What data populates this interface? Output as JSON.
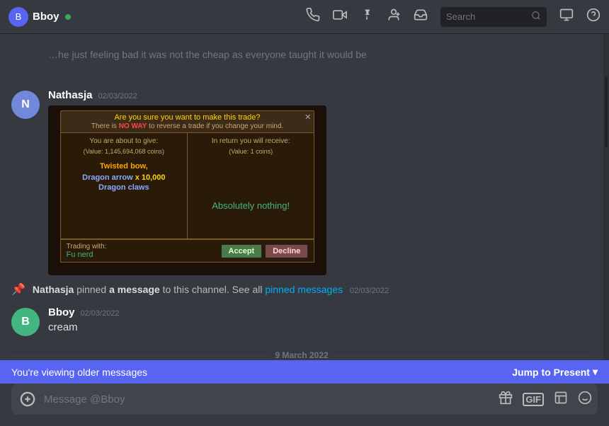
{
  "header": {
    "channel_icon": "B",
    "channel_name": "Bboy",
    "search_placeholder": "Search"
  },
  "messages": [
    {
      "id": "msg-nathasja-1",
      "username": "Nathasja",
      "timestamp": "02/03/2022",
      "type": "image",
      "avatar_initials": "N",
      "game_dialog": {
        "title": "Are you sure you want to make this trade?",
        "warning": "There is NO WAY to reverse a trade if you change your mind.",
        "no_way_text": "NO WAY",
        "left_label": "You are about to give:",
        "left_value": "(Value: 1,145,694,068 coins)",
        "item1": "Twisted bow,",
        "item2_prefix": "Dragon arrow",
        "item2_qty": " x 10,000",
        "item3": "Dragon claws",
        "right_label": "In return you will receive:",
        "right_value": "(Value: 1 coins)",
        "right_text": "Absolutely nothing!",
        "trading_with_label": "Trading with:",
        "trading_with_name": "Fu nerd",
        "btn_accept": "Accept",
        "btn_decline": "Decline"
      }
    },
    {
      "id": "msg-system",
      "type": "system",
      "username": "Nathasja",
      "action": "pinned",
      "bold_text": "a message",
      "action2": "to this channel. See all",
      "link_text": "pinned messages",
      "timestamp": "02/03/2022"
    },
    {
      "id": "msg-bboy",
      "username": "Bboy",
      "timestamp": "02/03/2022",
      "avatar_initials": "B",
      "type": "text",
      "text": "cream"
    }
  ],
  "date_divider": "9 March 2022",
  "older_messages_bar": {
    "text": "You're viewing older messages",
    "jump_label": "Jump to Present",
    "chevron": "▾"
  },
  "input": {
    "placeholder": "Message @Bboy"
  },
  "icons": {
    "call": "📞",
    "video": "📹",
    "pin": "📌",
    "add_member": "👤",
    "inbox": "📥",
    "search": "🔍",
    "help": "❓",
    "threads": "💬",
    "gift": "🎁",
    "gif": "GIF",
    "sticker": "🗒",
    "emoji": "😊",
    "add": "+"
  }
}
